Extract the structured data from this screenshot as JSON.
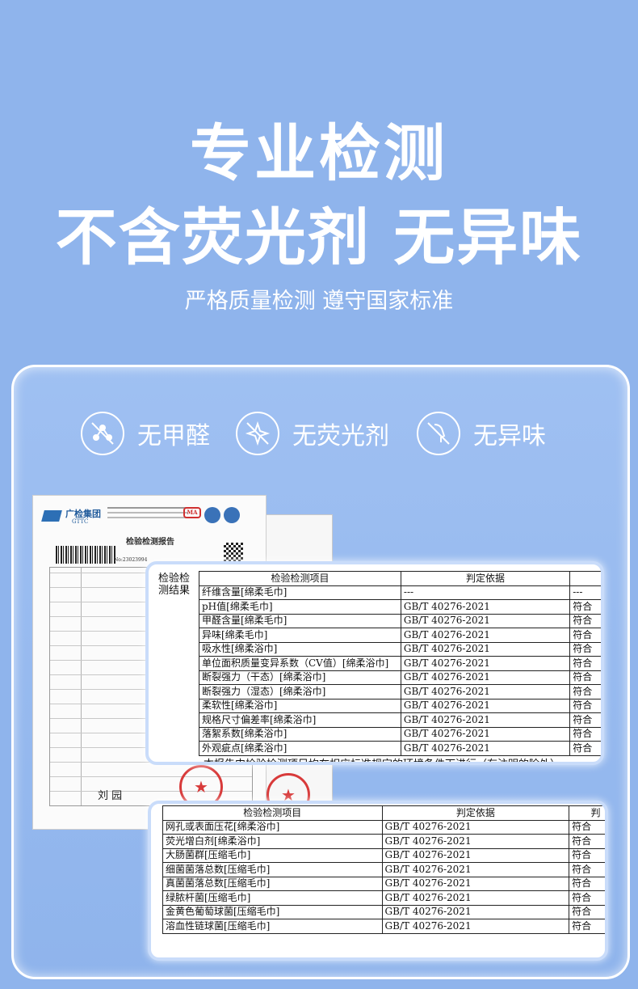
{
  "hero": {
    "title_line1": "专业检测",
    "title_line2": "不含荧光剂 无异味",
    "subtitle": "严格质量检测 遵守国家标准"
  },
  "features": [
    {
      "label": "无甲醛",
      "icon": "molecule-no-icon"
    },
    {
      "label": "无荧光剂",
      "icon": "sparkle-no-icon"
    },
    {
      "label": "无异味",
      "icon": "odor-no-icon"
    }
  ],
  "document": {
    "brand": "广检集团",
    "brand_sub": "GTTC",
    "title": "检验检测报告",
    "report_no": "No:23023994",
    "ma_mark": "MA",
    "signature": "刘 园"
  },
  "zoom1": {
    "left_label": "检验检测结果",
    "headers": [
      "检验检测项目",
      "判定依据",
      ""
    ],
    "rows": [
      [
        "纤维含量[绵柔毛巾]",
        "---",
        "---"
      ],
      [
        "pH值[绵柔毛巾]",
        "GB/T 40276-2021",
        "符合"
      ],
      [
        "甲醛含量[绵柔毛巾]",
        "GB/T 40276-2021",
        "符合"
      ],
      [
        "异味[绵柔毛巾]",
        "GB/T 40276-2021",
        "符合"
      ],
      [
        "吸水性[绵柔浴巾]",
        "GB/T 40276-2021",
        "符合"
      ],
      [
        "单位面积质量变异系数（CV值）[绵柔浴巾]",
        "GB/T 40276-2021",
        "符合"
      ],
      [
        "断裂强力（干态）[绵柔浴巾]",
        "GB/T 40276-2021",
        "符合"
      ],
      [
        "断裂强力（湿态）[绵柔浴巾]",
        "GB/T 40276-2021",
        "符合"
      ],
      [
        "柔软性[绵柔浴巾]",
        "GB/T 40276-2021",
        "符合"
      ],
      [
        "规格尺寸偏差率[绵柔浴巾]",
        "GB/T 40276-2021",
        "符合"
      ],
      [
        "落絮系数[绵柔浴巾]",
        "GB/T 40276-2021",
        "符合"
      ],
      [
        "外观疵点[绵柔浴巾]",
        "GB/T 40276-2021",
        "符合"
      ]
    ],
    "footer": "本报告中检验检测项目均在相应标准规定的环境条件下进行（有注明的除外）"
  },
  "zoom2": {
    "headers": [
      "检验检测项目",
      "判定依据",
      "判"
    ],
    "rows": [
      [
        "网孔或表面压花[绵柔浴巾]",
        "GB/T 40276-2021",
        "符合"
      ],
      [
        "荧光增白剂[绵柔浴巾]",
        "GB/T 40276-2021",
        "符合"
      ],
      [
        "大肠菌群[压缩毛巾]",
        "GB/T 40276-2021",
        "符合"
      ],
      [
        "细菌菌落总数[压缩毛巾]",
        "GB/T 40276-2021",
        "符合"
      ],
      [
        "真菌菌落总数[压缩毛巾]",
        "GB/T 40276-2021",
        "符合"
      ],
      [
        "绿脓杆菌[压缩毛巾]",
        "GB/T 40276-2021",
        "符合"
      ],
      [
        "金黄色葡萄球菌[压缩毛巾]",
        "GB/T 40276-2021",
        "符合"
      ],
      [
        "溶血性链球菌[压缩毛巾]",
        "GB/T 40276-2021",
        "符合"
      ]
    ]
  }
}
